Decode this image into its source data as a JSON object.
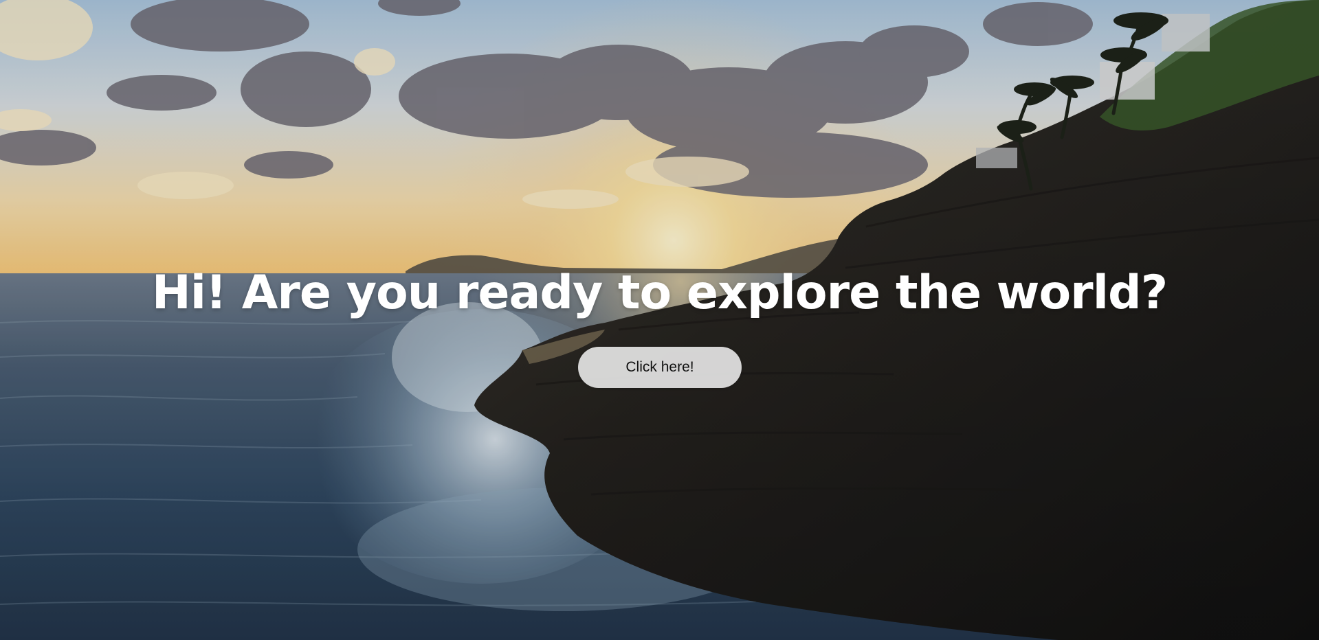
{
  "hero": {
    "headline": "Hi! Are you ready to explore the world?",
    "cta_label": "Click here!"
  }
}
